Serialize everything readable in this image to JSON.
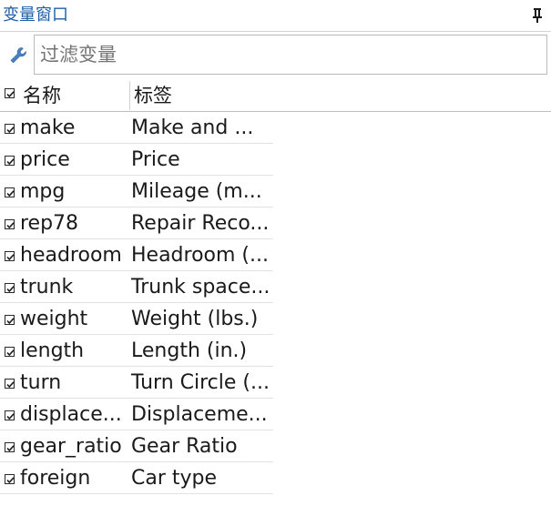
{
  "window": {
    "title": "变量窗口",
    "pin_icon": "pin-icon"
  },
  "filter": {
    "icon": "wrench-icon",
    "placeholder": "过滤变量",
    "value": ""
  },
  "columns": {
    "select_all_checked": true,
    "name": "名称",
    "label": "标签"
  },
  "variables": [
    {
      "name": "make",
      "label": "Make and ...",
      "checked": true
    },
    {
      "name": "price",
      "label": "Price",
      "checked": true
    },
    {
      "name": "mpg",
      "label": "Mileage (m...",
      "checked": true
    },
    {
      "name": "rep78",
      "label": "Repair Reco...",
      "checked": true
    },
    {
      "name": "headroom",
      "label": "Headroom (...",
      "checked": true
    },
    {
      "name": "trunk",
      "label": "Trunk space...",
      "checked": true
    },
    {
      "name": "weight",
      "label": "Weight (lbs.)",
      "checked": true
    },
    {
      "name": "length",
      "label": "Length (in.)",
      "checked": true
    },
    {
      "name": "turn",
      "label": "Turn Circle (...",
      "checked": true
    },
    {
      "name": "displace...",
      "label": "Displaceme...",
      "checked": true
    },
    {
      "name": "gear_ratio",
      "label": "Gear Ratio",
      "checked": true
    },
    {
      "name": "foreign",
      "label": "Car type",
      "checked": true
    }
  ],
  "colors": {
    "title": "#1d5ea8",
    "wrench": "#4a7fc1"
  }
}
